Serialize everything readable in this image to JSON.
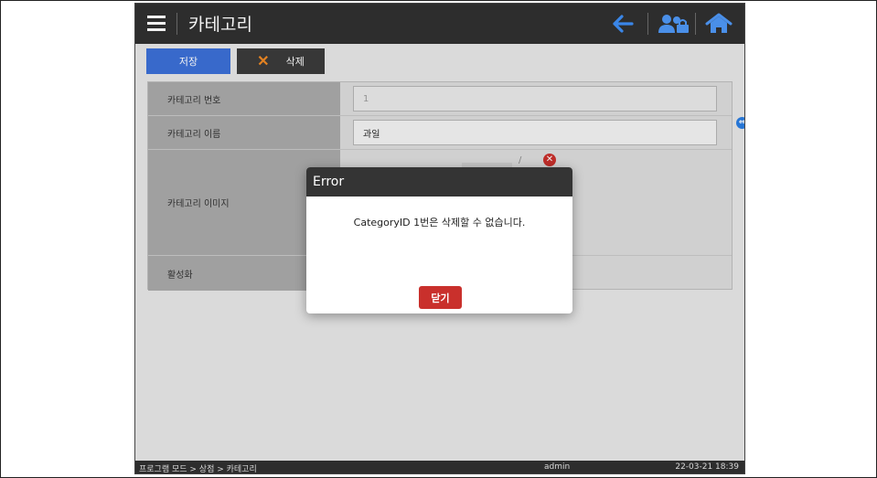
{
  "header": {
    "title": "카테고리",
    "menu_icon": "hamburger-menu-icon",
    "back_icon": "back-arrow-icon",
    "users_icon": "user-admin-icon",
    "home_icon": "home-icon"
  },
  "toolbar": {
    "save_label": "저장",
    "delete_label": "삭제",
    "delete_icon": "x-icon"
  },
  "form": {
    "rows": [
      {
        "label": "카테고리 번호",
        "value": "1"
      },
      {
        "label": "카테고리 이름",
        "value": "과일"
      },
      {
        "label": "카테고리 이미지",
        "slash": "/"
      },
      {
        "label": "활성화"
      }
    ]
  },
  "dialog": {
    "title": "Error",
    "message": "CategoryID 1번은 삭제할 수 없습니다.",
    "close_label": "닫기"
  },
  "statusbar": {
    "path": "프로그램 모드 > 상점 > 카테고리",
    "user": "admin",
    "datetime": "22-03-21 18:39"
  },
  "colors": {
    "primary": "#3b6fd6",
    "danger": "#c9302c",
    "dark": "#2d2d2d",
    "accent": "#f08a24"
  }
}
